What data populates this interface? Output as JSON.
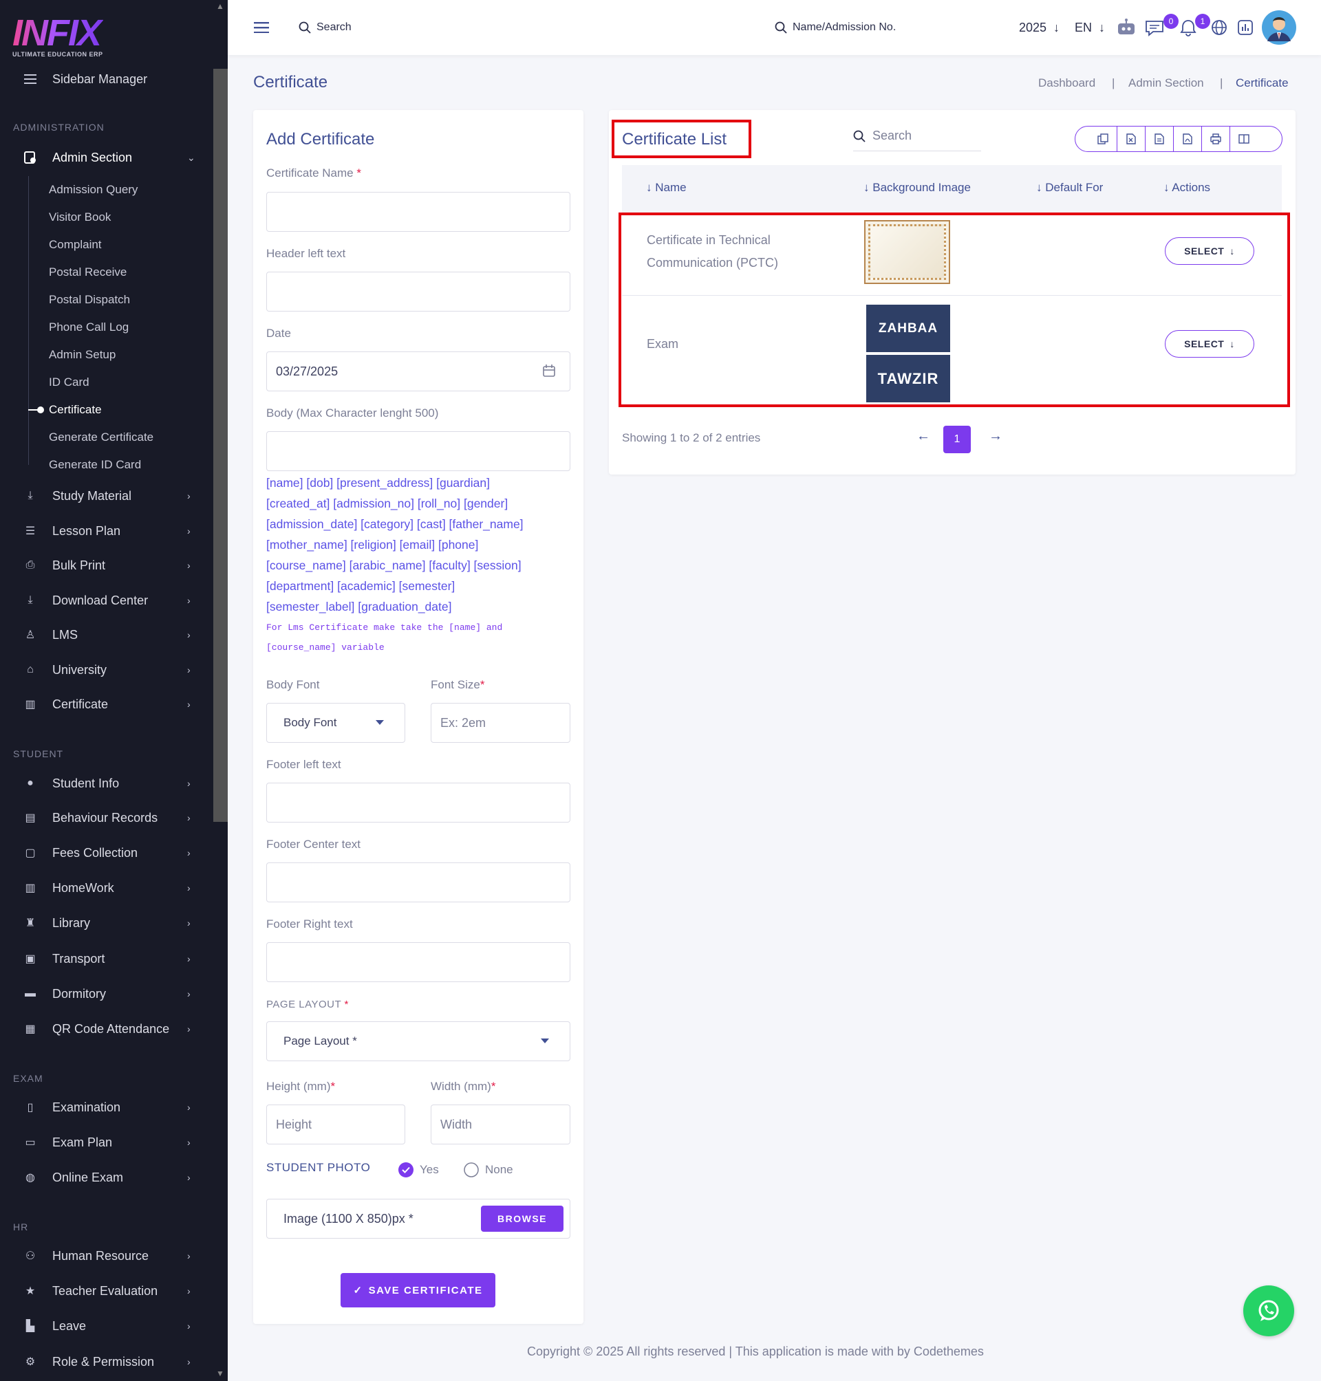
{
  "brand": {
    "logo_text": "INFIX",
    "logo_sub": "ULTIMATE EDUCATION ERP"
  },
  "sidebar": {
    "manager_label": "Sidebar Manager",
    "sections": {
      "administration": "ADMINISTRATION",
      "student": "STUDENT",
      "exam": "EXAM",
      "hr": "HR"
    },
    "admin_section": "Admin Section",
    "admin_sub": [
      "Admission Query",
      "Visitor Book",
      "Complaint",
      "Postal Receive",
      "Postal Dispatch",
      "Phone Call Log",
      "Admin Setup",
      "ID Card",
      "Certificate",
      "Generate Certificate",
      "Generate ID Card"
    ],
    "admin_items": [
      "Study Material",
      "Lesson Plan",
      "Bulk Print",
      "Download Center",
      "LMS",
      "University",
      "Certificate"
    ],
    "student_items": [
      "Student Info",
      "Behaviour Records",
      "Fees Collection",
      "HomeWork",
      "Library",
      "Transport",
      "Dormitory",
      "QR Code Attendance"
    ],
    "exam_items": [
      "Examination",
      "Exam Plan",
      "Online Exam"
    ],
    "hr_items": [
      "Human Resource",
      "Teacher Evaluation",
      "Leave",
      "Role & Permission"
    ]
  },
  "topbar": {
    "search_label": "Search",
    "student_search": "Name/Admission No.",
    "year": "2025",
    "lang": "EN",
    "msg_count": "0",
    "notif_count": "1"
  },
  "page": {
    "title": "Certificate",
    "breadcrumbs": [
      "Dashboard",
      "Admin Section",
      "Certificate"
    ]
  },
  "form": {
    "title": "Add Certificate",
    "cert_name_label": "Certificate Name",
    "header_left_label": "Header left text",
    "date_label": "Date",
    "date_value": "03/27/2025",
    "body_label": "Body (Max Character lenght 500)",
    "variables": [
      "[name] [dob] [present_address] [guardian]",
      "[created_at] [admission_no] [roll_no] [gender]",
      "[admission_date] [category] [cast] [father_name]",
      "[mother_name] [religion] [email] [phone]",
      "[course_name] [arabic_name] [faculty] [session]",
      "[department] [academic] [semester]",
      "[semester_label] [graduation_date]"
    ],
    "lms_note": [
      "For Lms Certificate make take the [name] and",
      "[course_name] variable"
    ],
    "body_font_label": "Body Font",
    "body_font_value": "Body Font",
    "font_size_label": "Font Size",
    "font_size_placeholder": "Ex: 2em",
    "footer_left_label": "Footer left text",
    "footer_center_label": "Footer Center text",
    "footer_right_label": "Footer Right text",
    "page_layout_label": "PAGE LAYOUT",
    "page_layout_value": "Page Layout *",
    "height_label": "Height (mm)",
    "height_placeholder": "Height",
    "width_label": "Width (mm)",
    "width_placeholder": "Width",
    "student_photo_label": "STUDENT PHOTO",
    "photo_yes": "Yes",
    "photo_none": "None",
    "image_label": "Image (1100 X 850)px *",
    "browse": "BROWSE",
    "save": "SAVE CERTIFICATE"
  },
  "list": {
    "title": "Certificate List",
    "search_placeholder": "Search",
    "columns": [
      "Name",
      "Background Image",
      "Default For",
      "Actions"
    ],
    "rows": [
      {
        "name_lines": [
          "Certificate in Technical",
          "Communication (PCTC)"
        ],
        "action": "SELECT"
      },
      {
        "name": "Exam",
        "image_lines": [
          "ZAHBAA",
          "TAWZIR"
        ],
        "action": "SELECT"
      }
    ],
    "showing": "Showing 1 to 2 of 2 entries",
    "page": "1"
  },
  "footer": {
    "copyright": "Copyright © 2025 All rights reserved | This application is made with by Codethemes"
  },
  "colors": {
    "accent": "#7c3aed",
    "sidebar_bg": "#181a27",
    "highlight": "#e3000f",
    "whatsapp": "#25d366"
  }
}
